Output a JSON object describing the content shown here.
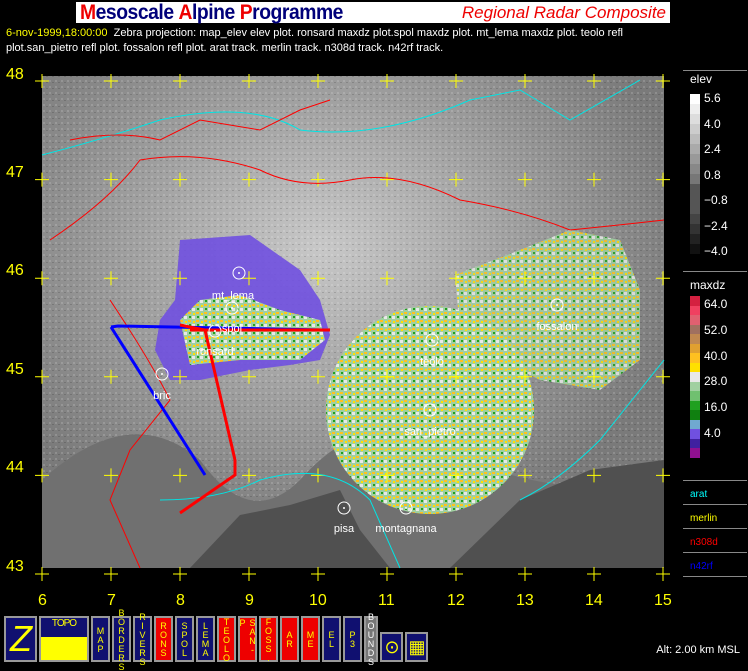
{
  "header": {
    "title_parts": [
      {
        "cap": "M",
        "rest": "esoscale "
      },
      {
        "cap": "A",
        "rest": "lpine "
      },
      {
        "cap": "P",
        "rest": "rogramme"
      }
    ],
    "subtitle": "Regional Radar Composite"
  },
  "info": {
    "timestamp": "6-nov-1999,18:00:00",
    "description": "Zebra projection: map_elev elev plot.  ronsard maxdz plot.spol maxdz  plot.  mt_lema maxdz  plot.  teolo refl plot.san_pietro refl  plot.  fossalon refl  plot.   arat track.   merlin track.   n308d track.   n42rf track."
  },
  "map": {
    "lat_labels": [
      "48",
      "47",
      "46",
      "45",
      "44",
      "43"
    ],
    "lon_labels": [
      "6",
      "7",
      "8",
      "9",
      "10",
      "11",
      "12",
      "13",
      "14",
      "15"
    ],
    "stations": [
      {
        "name": "mt_lema"
      },
      {
        "name": "spol"
      },
      {
        "name": "ronsard"
      },
      {
        "name": "bric"
      },
      {
        "name": "teolo"
      },
      {
        "name": "fossalon"
      },
      {
        "name": "san_pietro"
      },
      {
        "name": "pisa"
      },
      {
        "name": "montagnana"
      }
    ],
    "colors": {
      "grid": "#ffff00",
      "coast": "#00e5e5",
      "borders": "#ff0000",
      "station": "#ffffff"
    }
  },
  "legend": {
    "elev": {
      "title": "elev",
      "ticks": [
        "5.6",
        "4.0",
        "2.4",
        "0.8",
        "−0.8",
        "−2.4",
        "−4.0"
      ],
      "colors": [
        "#ffffff",
        "#eeeeee",
        "#dddddd",
        "#cccccc",
        "#bbbbbb",
        "#aaaaaa",
        "#999999",
        "#888888",
        "#777777",
        "#555555",
        "#555555",
        "#555555",
        "#444444",
        "#333333",
        "#222222",
        "#111111"
      ]
    },
    "maxdz": {
      "title": "maxdz",
      "ticks": [
        "64.0",
        "52.0",
        "40.0",
        "28.0",
        "16.0",
        "4.0"
      ],
      "colors": [
        "#d42040",
        "#f04060",
        "#e06070",
        "#a07060",
        "#c08850",
        "#e0a030",
        "#ffc020",
        "#ffe000",
        "#e8e8e8",
        "#a0d0a0",
        "#70c070",
        "#20a020",
        "#108010",
        "#70a8d0",
        "#7050e0",
        "#4020a0",
        "#901090"
      ]
    },
    "tracks": [
      {
        "name": "arat",
        "color": "#00ffff"
      },
      {
        "name": "merlin",
        "color": "#ffff00"
      },
      {
        "name": "n308d",
        "color": "#ff0000"
      },
      {
        "name": "n42rf",
        "color": "#0000ff"
      }
    ]
  },
  "toolbar": {
    "buttons": [
      {
        "label": "Z",
        "name": "zebra-logo-button",
        "bg": "#101070"
      },
      {
        "label": "TOPO",
        "name": "topo-button",
        "bg": "#101070"
      },
      {
        "label": "MAP",
        "name": "map-button",
        "bg": "#101070"
      },
      {
        "label": "BORDERS",
        "name": "borders-button",
        "bg": "#101070"
      },
      {
        "label": "RIVERS",
        "name": "rivers-button",
        "bg": "#101070"
      },
      {
        "label": "RONS",
        "name": "rons-button",
        "bg": "#ee0000"
      },
      {
        "label": "SPOL",
        "name": "spol-button",
        "bg": "#101070"
      },
      {
        "label": "LEMA",
        "name": "lema-button",
        "bg": "#101070"
      },
      {
        "label": "TEOLO",
        "name": "teolo-button",
        "bg": "#ee0000"
      },
      {
        "label": "SAN-P",
        "name": "san-p-button",
        "bg": "#ee0000"
      },
      {
        "label": "FOSS.",
        "name": "foss-button",
        "bg": "#ee0000"
      },
      {
        "label": "AR",
        "name": "ar-button",
        "bg": "#ee0000"
      },
      {
        "label": "ME",
        "name": "me-button",
        "bg": "#ee0000"
      },
      {
        "label": "EL",
        "name": "el-button",
        "bg": "#101070"
      },
      {
        "label": "P3",
        "name": "p3-button",
        "bg": "#101070"
      },
      {
        "label": "BOUNDS",
        "name": "bounds-button",
        "bg": "#777777"
      }
    ],
    "altitude": "Alt: 2.00 km MSL"
  }
}
